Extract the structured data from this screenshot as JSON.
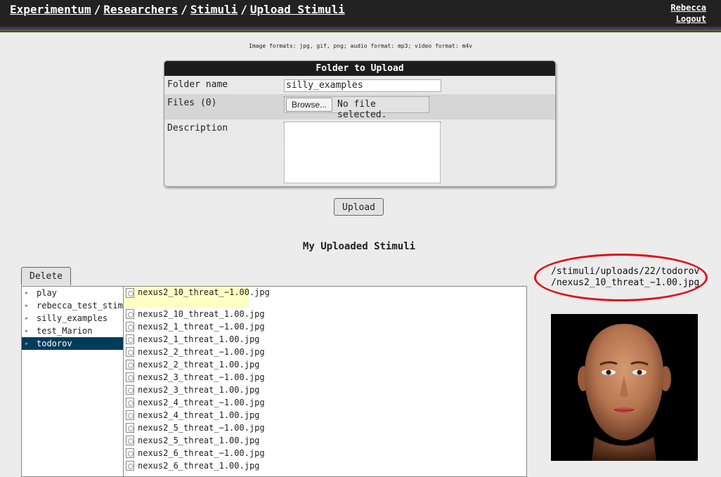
{
  "breadcrumb": {
    "items": [
      "Experimentum",
      "Researchers",
      "Stimuli",
      "Upload Stimuli"
    ],
    "separator": "/"
  },
  "user": {
    "name": "Rebecca",
    "logout": "Logout"
  },
  "formats_note": "Image formats: jpg, gif, png; audio format: mp3; video format: m4v",
  "upload_form": {
    "title": "Folder to Upload",
    "folder_label": "Folder name",
    "folder_value": "silly_examples",
    "files_label": "Files (0)",
    "browse_label": "Browse...",
    "no_file": "No file selected.",
    "description_label": "Description",
    "description_value": "",
    "upload_button": "Upload"
  },
  "stimuli": {
    "title": "My Uploaded Stimuli",
    "delete_button": "Delete",
    "folders": [
      "play",
      "rebecca_test_stim",
      "silly_examples",
      "test_Marion",
      "todorov"
    ],
    "selected_folder": "todorov",
    "files": [
      "nexus2_10_threat_−1.00.jpg",
      "nexus2_10_threat_1.00.jpg",
      "nexus2_1_threat_−1.00.jpg",
      "nexus2_1_threat_1.00.jpg",
      "nexus2_2_threat_−1.00.jpg",
      "nexus2_2_threat_1.00.jpg",
      "nexus2_3_threat_−1.00.jpg",
      "nexus2_3_threat_1.00.jpg",
      "nexus2_4_threat_−1.00.jpg",
      "nexus2_4_threat_1.00.jpg",
      "nexus2_5_threat_−1.00.jpg",
      "nexus2_5_threat_1.00.jpg",
      "nexus2_6_threat_−1.00.jpg",
      "nexus2_6_threat_1.00.jpg"
    ],
    "selected_file": "nexus2_10_threat_−1.00.jpg",
    "selected_path_line1": "/stimuli/uploads/22/todorov",
    "selected_path_line2": "/nexus2_10_threat_−1.00.jpg"
  },
  "colors": {
    "topbar": "#222222",
    "selected_folder_bg": "#003d5b",
    "selected_file_bg": "#ffffc4",
    "highlight_ellipse": "#e0101a"
  }
}
